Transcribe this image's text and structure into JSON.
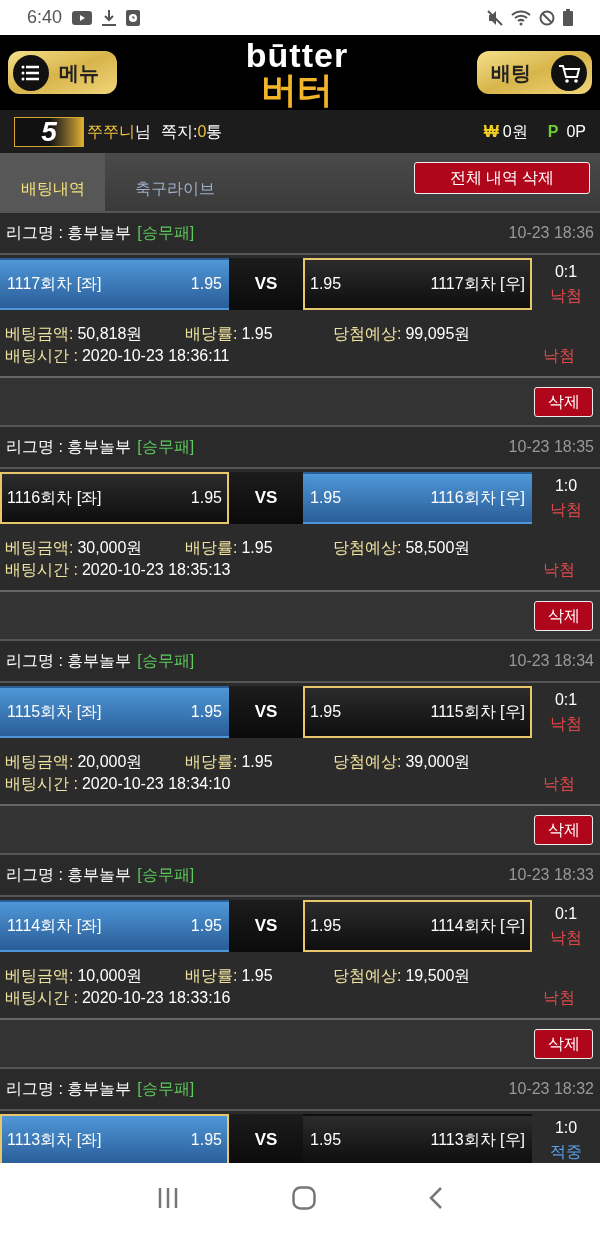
{
  "status_bar": {
    "time": "6:40"
  },
  "header": {
    "menu_button": "메뉴",
    "logo_top": "būtter",
    "logo_bottom": "버터",
    "bet_button": "배팅"
  },
  "user_bar": {
    "level": "5",
    "nickname": "쭈쭈니",
    "honorific": "님",
    "messages_label": "쪽지:",
    "messages_count": "0",
    "messages_unit": "통",
    "cash_symbol": "₩",
    "cash": "0원",
    "points_symbol": "P",
    "points": "0P"
  },
  "tabs": [
    {
      "label": "배팅내역",
      "selected": true
    },
    {
      "label": "축구라이브",
      "selected": false
    }
  ],
  "delete_all_button": "전체 내역 삭제",
  "bets": [
    {
      "league": "리그명 : 흥부놀부",
      "bet_type": "[승무패]",
      "time": "10-23 18:36",
      "left": {
        "label": "1117회차 [좌]",
        "odds": "1.95",
        "selected": true,
        "winner": false
      },
      "vs": "VS",
      "right": {
        "label": "1117회차 [우]",
        "odds": "1.95",
        "selected": false,
        "winner": true
      },
      "score": "0:1",
      "result": {
        "text": "낙첨",
        "kind": "lose"
      },
      "amount_label": "베팅금액:",
      "amount": "50,818원",
      "odds_label": "배당률:",
      "odds": "1.95",
      "expected_label": "당첨예상:",
      "expected": "99,095원",
      "time_label": "배팅시간 :",
      "bet_time": "2020-10-23 18:36:11",
      "status": {
        "text": "낙첨",
        "kind": "lose"
      },
      "delete_button": "삭제"
    },
    {
      "league": "리그명 : 흥부놀부",
      "bet_type": "[승무패]",
      "time": "10-23 18:35",
      "left": {
        "label": "1116회차 [좌]",
        "odds": "1.95",
        "selected": false,
        "winner": true
      },
      "vs": "VS",
      "right": {
        "label": "1116회차 [우]",
        "odds": "1.95",
        "selected": true,
        "winner": false
      },
      "score": "1:0",
      "result": {
        "text": "낙첨",
        "kind": "lose"
      },
      "amount_label": "베팅금액:",
      "amount": "30,000원",
      "odds_label": "배당률:",
      "odds": "1.95",
      "expected_label": "당첨예상:",
      "expected": "58,500원",
      "time_label": "배팅시간 :",
      "bet_time": "2020-10-23 18:35:13",
      "status": {
        "text": "낙첨",
        "kind": "lose"
      },
      "delete_button": "삭제"
    },
    {
      "league": "리그명 : 흥부놀부",
      "bet_type": "[승무패]",
      "time": "10-23 18:34",
      "left": {
        "label": "1115회차 [좌]",
        "odds": "1.95",
        "selected": true,
        "winner": false
      },
      "vs": "VS",
      "right": {
        "label": "1115회차 [우]",
        "odds": "1.95",
        "selected": false,
        "winner": true
      },
      "score": "0:1",
      "result": {
        "text": "낙첨",
        "kind": "lose"
      },
      "amount_label": "베팅금액:",
      "amount": "20,000원",
      "odds_label": "배당률:",
      "odds": "1.95",
      "expected_label": "당첨예상:",
      "expected": "39,000원",
      "time_label": "배팅시간 :",
      "bet_time": "2020-10-23 18:34:10",
      "status": {
        "text": "낙첨",
        "kind": "lose"
      },
      "delete_button": "삭제"
    },
    {
      "league": "리그명 : 흥부놀부",
      "bet_type": "[승무패]",
      "time": "10-23 18:33",
      "left": {
        "label": "1114회차 [좌]",
        "odds": "1.95",
        "selected": true,
        "winner": false
      },
      "vs": "VS",
      "right": {
        "label": "1114회차 [우]",
        "odds": "1.95",
        "selected": false,
        "winner": true
      },
      "score": "0:1",
      "result": {
        "text": "낙첨",
        "kind": "lose"
      },
      "amount_label": "베팅금액:",
      "amount": "10,000원",
      "odds_label": "배당률:",
      "odds": "1.95",
      "expected_label": "당첨예상:",
      "expected": "19,500원",
      "time_label": "배팅시간 :",
      "bet_time": "2020-10-23 18:33:16",
      "status": {
        "text": "낙첨",
        "kind": "lose"
      },
      "delete_button": "삭제"
    },
    {
      "league": "리그명 : 흥부놀부",
      "bet_type": "[승무패]",
      "time": "10-23 18:32",
      "left": {
        "label": "1113회차 [좌]",
        "odds": "1.95",
        "selected": true,
        "winner": true
      },
      "vs": "VS",
      "right": {
        "label": "1113회차 [우]",
        "odds": "1.95",
        "selected": false,
        "winner": false
      },
      "score": "1:0",
      "result": {
        "text": "적중",
        "kind": "win"
      }
    }
  ]
}
